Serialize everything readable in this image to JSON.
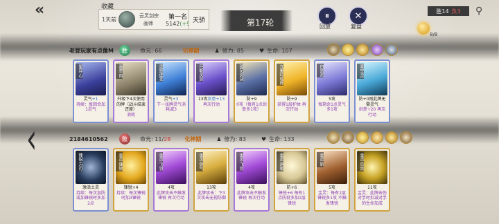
{
  "topbar": {
    "collect_label": "收藏",
    "rank_text": "1天前",
    "player_name": "云灵剑宗",
    "player_realm": "画师",
    "first_place": "第一名",
    "score": "5142",
    "score_delta": "(+94)",
    "tier": "天骄",
    "round": "第17轮",
    "replay_label": "回放",
    "review_label": "复盘",
    "wins_label": "胜14",
    "losses_label": "负3",
    "orb_count": "8/8"
  },
  "player1": {
    "name": "老登玩家有点像M",
    "result": "胜",
    "hp_label": "命元:",
    "hp_value": "66",
    "realm": "化神期",
    "cult_label": "修为:",
    "cult_value": "85",
    "life_label": "生命:",
    "life_value": "107",
    "cards": [
      {
        "name": "星弈·心",
        "level": "",
        "desc1": "灵气",
        "desc1b": "+1",
        "desc2": "持续：每回合加1灵气",
        "art": "linear-gradient(160deg,#a7b8f0,#3a3f9a 60%,#1c1e50)",
        "cls": "blue"
      },
      {
        "name": "画意·风",
        "level": "",
        "desc1": "升级下4次使用的牌（战斗结束还原）",
        "desc1b": "",
        "desc2": "消耗",
        "art": "linear-gradient(160deg,#e9dfc7,#8c826a 60%,#3b3528)",
        "cls": "purple"
      },
      {
        "name": "灵感迸发",
        "level": "",
        "desc1": "灵气",
        "desc1b": "+3",
        "desc2": "下一张牌灵气消耗减3",
        "art": "linear-gradient(160deg,#c9e6ff,#3e7fd6 55%,#10244f)",
        "cls": "blue"
      },
      {
        "name": "巨斩灵剑",
        "level": "",
        "desc1": "13攻",
        "desc1b": "剑意+13",
        "desc2": "再次行动",
        "art": "linear-gradient(160deg,#dcd2ff,#6a4fc9 55%,#241a4f)",
        "cls": "purple"
      },
      {
        "name": "镜花剑诀",
        "level": "",
        "desc1": "防+9",
        "desc1b": "",
        "desc2": "0攻（每有1点剑意多1攻）",
        "art": "linear-gradient(160deg,#f3e6b8,#5a6fa5 55%,#1d2a4f)",
        "cls": "gold"
      },
      {
        "name": "九重玲珑阵",
        "level": "",
        "desc1": "防+9",
        "desc1b": "",
        "desc2": "获得1层护体 再次行动",
        "art": "linear-gradient(160deg,#fff3b0,#f0b428 55%,#7a4a08)",
        "cls": "gold"
      },
      {
        "name": "白剑灵",
        "level": "",
        "desc1": "5攻",
        "desc1b": "",
        "desc2": "每剩余1点灵气多1攻",
        "art": "linear-gradient(160deg,#e8e8ff,#7c7ad6 55%,#2b2a6a)",
        "cls": "blue"
      },
      {
        "name": "索空·灵",
        "level": "",
        "desc1": "防+0则此牌无需灵气",
        "desc1b": "",
        "desc2": "剑意+20 再次行动",
        "art": "linear-gradient(160deg,#d8f7ff,#4aa9d8 55%,#103a55)",
        "cls": "blue"
      }
    ]
  },
  "player2": {
    "name": "2184610562",
    "result": "败",
    "hp_label": "命元:",
    "hp_value": "11",
    "hp_max": "28",
    "realm": "化神期",
    "cult_label": "修为:",
    "cult_value": "83",
    "life_label": "生命:",
    "life_value": "133",
    "cards": [
      {
        "name": "锋锐·万刃",
        "level": "",
        "desc1": "激活土灵",
        "desc1b": "",
        "desc2": "持续：每次加防或加锋锐时多加2点",
        "art": "radial-gradient(circle at 50% 50%,#9fb6d8,#273a5a 60%,#0d1526)",
        "cls": "blue"
      },
      {
        "name": "金灵·锋锐",
        "level": "",
        "desc1": "锋锐+4",
        "desc1b": "",
        "desc2": "持续：每次锋锐时加3锋锐",
        "art": "radial-gradient(circle at 50% 45%,#fff0a0,#e3a81e 55%,#6a4708)",
        "cls": "gold"
      },
      {
        "name": "金灵·飞羽",
        "level": "",
        "desc1": "4攻",
        "desc1b": "",
        "desc2": "此牌攻击不触发锋锐 再次行动",
        "art": "linear-gradient(160deg,#f4d2ff,#a34cd8 50%,#3a0f5a)",
        "cls": "purple"
      },
      {
        "name": "金灵·剑气",
        "level": "",
        "desc1": "13攻",
        "desc1b": "",
        "desc2": "此牌攻击：下3次攻击无视防御",
        "art": "linear-gradient(160deg,#fff3c8,#d9b040 50%,#5a3e0a)",
        "cls": "gold"
      },
      {
        "name": "金灵·飞羽",
        "level": "",
        "desc1": "4攻",
        "desc1b": "",
        "desc2": "此牌攻击不触发锋锐 再次行动",
        "art": "linear-gradient(160deg,#f4d2ff,#a34cd8 50%,#3a0f5a)",
        "cls": "purple"
      },
      {
        "name": "金灵·洞吸",
        "level": "",
        "desc1": "防+6",
        "desc1b": "",
        "desc2": "锋锐+6 每有1点防就多加1层锋锐",
        "art": "radial-gradient(circle at 50% 45%,#fff8d8,#d8c896 55%,#5e5030)",
        "cls": "gold"
      },
      {
        "name": "金灵·斩",
        "level": "",
        "desc1": "5攻",
        "desc1b": "",
        "desc2": "金灵：每有1层锋锐多1攻 不触发锋锐",
        "art": "linear-gradient(160deg,#ffe6c8,#a06030 55%,#3a1e0a)",
        "cls": "gold"
      },
      {
        "name": "金灵·巨剑",
        "level": "",
        "desc1": "11攻",
        "desc1b": "",
        "desc2": "金灵：此牌击伤对手时扣减对手的生命加成",
        "art": "radial-gradient(circle at 50% 50%,#fff4b0,#c8a426 50%,#3e3208)",
        "cls": "gold"
      }
    ]
  },
  "colors": {
    "accent_gold": "#d69a18",
    "realm_orange": "#c0660f",
    "win_green": "#3c8a3c",
    "lose_red": "#c33"
  }
}
